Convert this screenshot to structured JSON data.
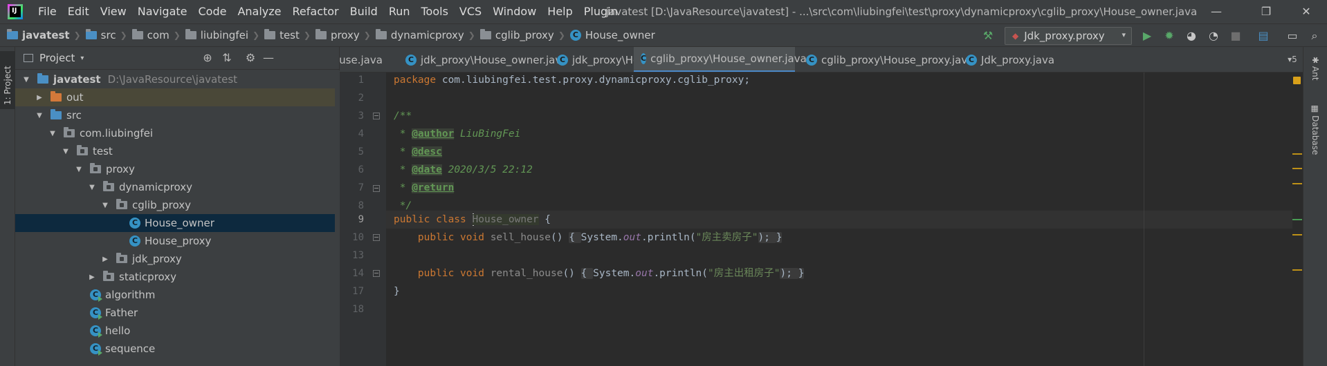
{
  "window": {
    "app_logo": "IJ",
    "menu": [
      "File",
      "Edit",
      "View",
      "Navigate",
      "Code",
      "Analyze",
      "Refactor",
      "Build",
      "Run",
      "Tools",
      "VCS",
      "Window",
      "Help",
      "Plugin"
    ],
    "title": "javatest [D:\\JavaResource\\javatest] - ...\\src\\com\\liubingfei\\test\\proxy\\dynamicproxy\\cglib_proxy\\House_owner.java",
    "minimize_icon": "—",
    "maximize_icon": "❐",
    "close_icon": "✕"
  },
  "breadcrumb": [
    "javatest",
    "src",
    "com",
    "liubingfei",
    "test",
    "proxy",
    "dynamicproxy",
    "cglib_proxy",
    "House_owner"
  ],
  "toolbar": {
    "build_icon": "hammer-icon",
    "run_config": "Jdk_proxy.proxy",
    "run_config_arrow": "▾",
    "icons": [
      "run-icon",
      "debug-icon",
      "coverage-icon",
      "profile-icon",
      "stop-icon",
      "project-structure-icon",
      "terminal-icon",
      "search-everywhere-icon"
    ]
  },
  "left_strip": {
    "project_tab": "1: Project"
  },
  "project_panel": {
    "title": "Project",
    "dropdown": "▾",
    "tree": [
      {
        "label": "javatest",
        "path": "D:\\JavaResource\\javatest",
        "depth": 0,
        "expanded": true,
        "kind": "module",
        "bold": true
      },
      {
        "label": "out",
        "depth": 1,
        "expanded": false,
        "kind": "folder-orange",
        "hover": true
      },
      {
        "label": "src",
        "depth": 1,
        "expanded": true,
        "kind": "folder-blue"
      },
      {
        "label": "com.liubingfei",
        "depth": 2,
        "expanded": true,
        "kind": "package"
      },
      {
        "label": "test",
        "depth": 3,
        "expanded": true,
        "kind": "package"
      },
      {
        "label": "proxy",
        "depth": 4,
        "expanded": true,
        "kind": "package"
      },
      {
        "label": "dynamicproxy",
        "depth": 5,
        "expanded": true,
        "kind": "package"
      },
      {
        "label": "cglib_proxy",
        "depth": 6,
        "expanded": true,
        "kind": "package"
      },
      {
        "label": "House_owner",
        "depth": 7,
        "kind": "class",
        "selected": true
      },
      {
        "label": "House_proxy",
        "depth": 7,
        "kind": "class"
      },
      {
        "label": "jdk_proxy",
        "depth": 6,
        "expanded": false,
        "kind": "package"
      },
      {
        "label": "staticproxy",
        "depth": 5,
        "expanded": false,
        "kind": "package"
      },
      {
        "label": "algorithm",
        "depth": 4,
        "kind": "class-exec"
      },
      {
        "label": "Father",
        "depth": 4,
        "kind": "class-exec"
      },
      {
        "label": "hello",
        "depth": 4,
        "kind": "class-exec"
      },
      {
        "label": "sequence",
        "depth": 4,
        "kind": "class-exec"
      }
    ]
  },
  "tabs": [
    {
      "label": "ouse.java",
      "icon": false,
      "active": false
    },
    {
      "label": "jdk_proxy\\House_owner.java",
      "icon": true,
      "active": false
    },
    {
      "label": "jdk_proxy\\House_proxy.java",
      "icon": true,
      "active": false,
      "close": "×"
    },
    {
      "label": "cglib_proxy\\House_owner.java",
      "icon": true,
      "active": true
    },
    {
      "label": "cglib_proxy\\House_proxy.java",
      "icon": true,
      "active": false
    },
    {
      "label": "Jdk_proxy.java",
      "icon": true,
      "active": false
    }
  ],
  "tabs_more": "▾5",
  "right_strip": [
    "Ant",
    "Database"
  ],
  "editor": {
    "current_line": "9",
    "line_numbers": [
      "1",
      "2",
      "3",
      "4",
      "5",
      "6",
      "7",
      "8",
      "9",
      "10",
      "13",
      "14",
      "17",
      "18"
    ],
    "code": {
      "l1_kw": "package",
      "l1_rest": " com.liubingfei.test.proxy.dynamicproxy.cglib_proxy;",
      "l3": "/**",
      "l4_pre": " * ",
      "l4_tag": "@author",
      "l4_rest": " LiuBingFei",
      "l5_pre": " * ",
      "l5_tag": "@desc",
      "l6_pre": " * ",
      "l6_tag": "@date",
      "l6_rest": " 2020/3/5 22:12",
      "l7_pre": " * ",
      "l7_tag": "@return",
      "l8": " */",
      "l9_kw": "public class ",
      "l9_name": "House_owner",
      "l9_rest": " {",
      "l10_kw": "    public void ",
      "l10_fn": "sell_house",
      "l10_paren": "() ",
      "l10_body_open": "{ ",
      "l10_call1": "System.",
      "l10_out": "out",
      "l10_call2": ".println(",
      "l10_str": "\"房主卖房子\"",
      "l10_end": "); ",
      "l10_close": "}",
      "l14_kw": "    public void ",
      "l14_fn": "rental_house",
      "l14_paren": "() ",
      "l14_body_open": "{ ",
      "l14_call1": "System.",
      "l14_out": "out",
      "l14_call2": ".println(",
      "l14_str": "\"房主出租房子\"",
      "l14_end": "); ",
      "l14_close": "}",
      "l17": "}"
    }
  }
}
